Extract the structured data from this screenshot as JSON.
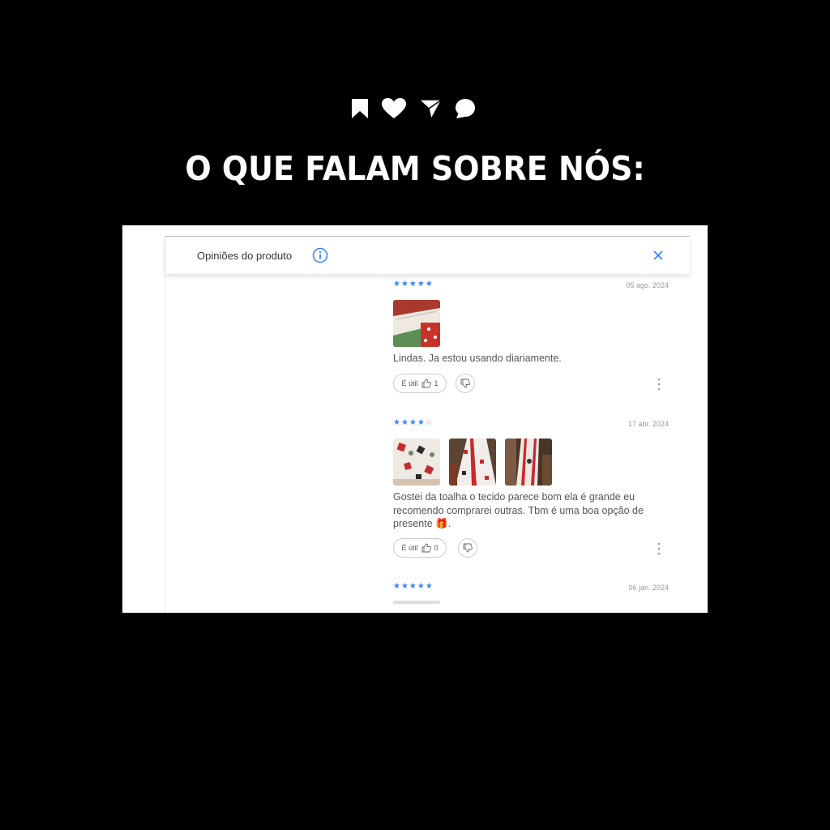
{
  "headline": "O QUE FALAM SOBRE NÓS:",
  "social_icons": [
    "bookmark-icon",
    "heart-icon",
    "send-icon",
    "comment-icon"
  ],
  "panel": {
    "title": "Opiniões do produto",
    "info_icon": "info-icon",
    "close_icon": "close-icon"
  },
  "colors": {
    "accent": "#3483fa",
    "background": "#000000",
    "card": "#ffffff"
  },
  "reviews": [
    {
      "rating": 5,
      "date": "05 ago. 2024",
      "photos": 1,
      "text": "Lindas. Ja estou usando diariamente.",
      "helpful_label": "É útil",
      "helpful_count": "1"
    },
    {
      "rating": 4,
      "date": "17 abr. 2024",
      "photos": 3,
      "text": "Gostei da toalha o tecido parece bom ela é grande eu recomendo comprarei outras. Tbm é uma boa opção de presente 🎁.",
      "helpful_label": "É útil",
      "helpful_count": "0"
    },
    {
      "rating": 5,
      "date": "06 jan. 2024"
    }
  ]
}
